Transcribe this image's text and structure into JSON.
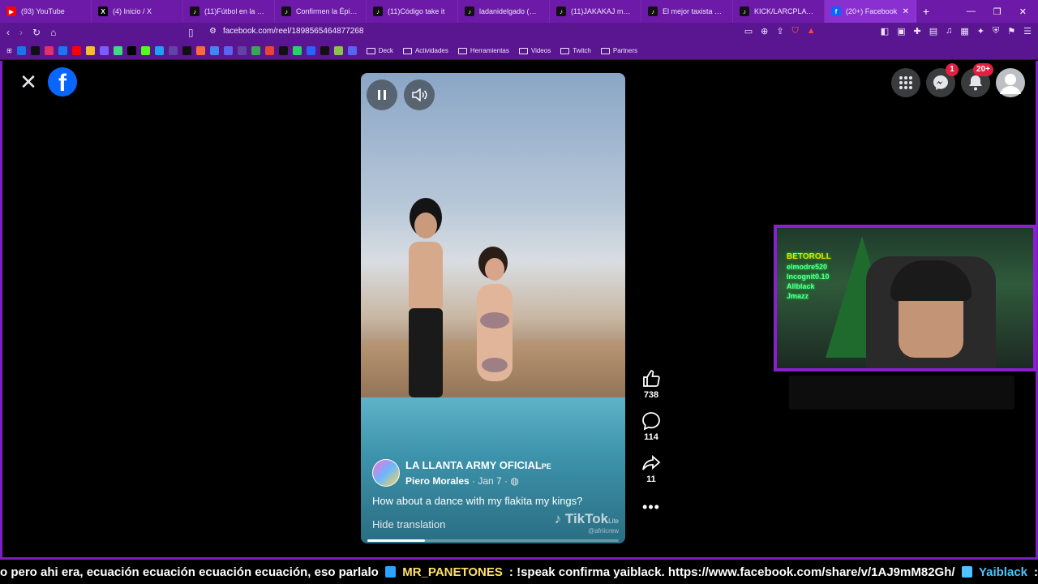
{
  "tabs": [
    {
      "title": "(93) YouTube",
      "favicon_color": "#ff0000",
      "glyph": "▶"
    },
    {
      "title": "(4) Inicio / X",
      "favicon_color": "#000000",
      "glyph": "X"
    },
    {
      "title": "(11)Fútbol en la Monta...",
      "favicon_color": "#111111",
      "glyph": "♪"
    },
    {
      "title": "Confirmen la Épica de...",
      "favicon_color": "#111111",
      "glyph": "♪"
    },
    {
      "title": "(11)Código take it",
      "favicon_color": "#111111",
      "glyph": "♪"
    },
    {
      "title": "ladanidelgado (@lada...",
      "favicon_color": "#111111",
      "glyph": "♪"
    },
    {
      "title": "(11)JAKAKAJ me dió m...",
      "favicon_color": "#111111",
      "glyph": "♪"
    },
    {
      "title": "El mejor taxista en Ma...",
      "favicon_color": "#111111",
      "glyph": "♪"
    },
    {
      "title": "KICK/LARCPLAY: Lo qu...",
      "favicon_color": "#111111",
      "glyph": "♪"
    },
    {
      "title": "(20+) Facebook",
      "favicon_color": "#0866ff",
      "glyph": "f",
      "active": true
    }
  ],
  "url": "facebook.com/reel/1898565464877268",
  "bookmarks": {
    "folders": [
      "Deck",
      "Actividades",
      "Herramientas",
      "Videos",
      "Twitch",
      "Partners"
    ]
  },
  "header": {
    "messenger_badge": "1",
    "notifications_badge": "20+"
  },
  "reel": {
    "page_name": "LA LLANTA ARMY OFICIAL",
    "page_suffix": "PE",
    "author": "Piero Morales",
    "date": " · Jan 7 · ",
    "caption": "How about a dance with my flakita my kings?",
    "hide_translation": "Hide translation",
    "watermark": "TikTok",
    "watermark_suffix": "Lite",
    "watermark_user": "@afriicrew",
    "progress_fraction": 0.23
  },
  "actions": {
    "likes": "738",
    "comments": "114",
    "shares": "11"
  },
  "webcam": {
    "names": [
      "BETOROLL",
      "elmodre520",
      "Incognit0.10",
      "Allblack",
      "Jmazz"
    ]
  },
  "ticker": {
    "lead": "o pero ahi era, ecuación ecuación ecuación ecuación, eso parlalo",
    "user1": "MR_PANETONES",
    "msg1": ": !speak confirma yaiblack. https://www.facebook.com/share/v/1AJ9mM82Gh/",
    "user2": "Yaiblack",
    "msg2": ":"
  }
}
